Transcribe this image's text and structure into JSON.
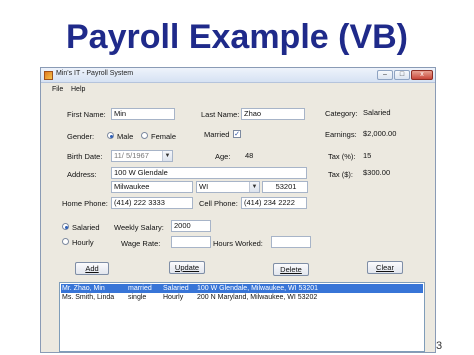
{
  "slide": {
    "title": "Payroll Example (VB)",
    "page_number": "3"
  },
  "window": {
    "title": "Min's IT - Payroll System",
    "controls": {
      "minimize": "–",
      "maximize": "□",
      "close": "x"
    }
  },
  "menu": [
    "File",
    "Help"
  ],
  "form": {
    "first_name_label": "First Name:",
    "first_name_value": "Min",
    "last_name_label": "Last Name:",
    "last_name_value": "Zhao",
    "gender_label": "Gender:",
    "gender_male": "Male",
    "gender_female": "Female",
    "gender_selected": "Male",
    "married_label": "Married",
    "married_checked": true,
    "birth_date_label": "Birth Date:",
    "birth_date_value": "11/ 5/1967",
    "age_label": "Age:",
    "age_value": "48",
    "address_label": "Address:",
    "address_street": "100 W Glendale",
    "address_city": "Milwaukee",
    "address_state": "WI",
    "address_zip": "53201",
    "home_phone_label": "Home Phone:",
    "home_phone_value": "(414) 222 3333",
    "cell_phone_label": "Cell Phone:",
    "cell_phone_value": "(414) 234 2222",
    "category_label": "Category:",
    "category_value": "Salaried",
    "earnings_label": "Earnings:",
    "earnings_value": "$2,000.00",
    "tax_pct_label": "Tax (%):",
    "tax_pct_value": "15",
    "tax_dollar_label": "Tax ($):",
    "tax_dollar_value": "$300.00",
    "salaried_label": "Salaried",
    "hourly_label": "Hourly",
    "pay_type_selected": "Salaried",
    "weekly_salary_label": "Weekly Salary:",
    "weekly_salary_value": "2000",
    "wage_rate_label": "Wage Rate:",
    "wage_rate_value": "",
    "hours_worked_label": "Hours Worked:",
    "hours_worked_value": ""
  },
  "buttons": {
    "add": "Add",
    "update": "Update",
    "delete": "Delete",
    "clear": "Clear"
  },
  "employees": [
    {
      "name": "Mr. Zhao, Min",
      "status": "married",
      "category": "Salaried",
      "address": "100 W Glendale, Milwaukee, WI 53201",
      "selected": true
    },
    {
      "name": "Ms. Smith, Linda",
      "status": "single",
      "category": "Hourly",
      "address": "200 N Maryland, Milwaukee, WI 53202",
      "selected": false
    }
  ],
  "colors": {
    "title_blue": "#1f2a8a",
    "selection_blue": "#3875d7",
    "window_bg": "#ece9e0"
  }
}
